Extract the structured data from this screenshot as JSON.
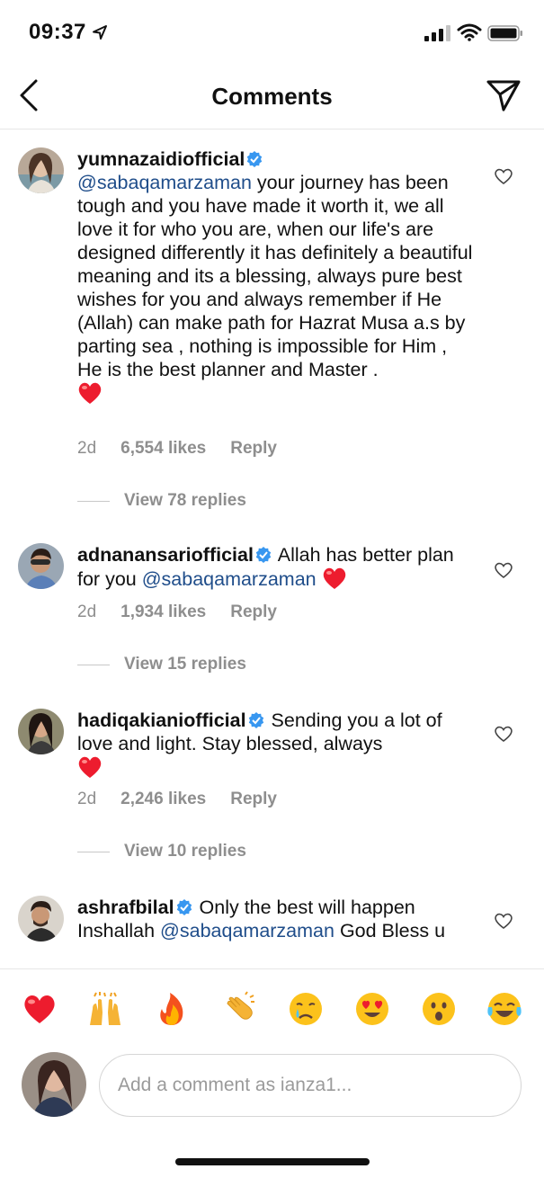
{
  "status": {
    "time": "09:37"
  },
  "header": {
    "title": "Comments"
  },
  "comments": [
    {
      "user": "yumnazaidiofficial",
      "mention": "@sabaqamarzaman",
      "text": " your journey has been tough and you have made it worth it, we all love it for who you are, when our life's are designed differently it has definitely a beautiful meaning and its a blessing, always pure best wishes for you and always remember if He (Allah) can make path for Hazrat Musa a.s  by parting sea , nothing is impossible for Him , He is the best planner and Master .",
      "age": "2d",
      "likes": "6,554 likes",
      "reply": "Reply",
      "view_replies": "View 78 replies"
    },
    {
      "user": "adnanansariofficial",
      "text_before": " Allah has better plan for you ",
      "mention": "@sabaqamarzaman",
      "age": "2d",
      "likes": "1,934 likes",
      "reply": "Reply",
      "view_replies": "View 15 replies"
    },
    {
      "user": "hadiqakianiofficial",
      "text": " Sending you a lot of love and light. Stay blessed, always",
      "age": "2d",
      "likes": "2,246 likes",
      "reply": "Reply",
      "view_replies": "View 10 replies"
    },
    {
      "user": "ashrafbilal",
      "text_before": " Only the best will happen Inshallah ",
      "mention": "@sabaqamarzaman",
      "text_after": " God Bless u"
    }
  ],
  "emoji_bar": [
    "heart-emoji",
    "raised-hands-emoji",
    "fire-emoji",
    "clapping-emoji",
    "crying-face-emoji",
    "heart-eyes-emoji",
    "surprised-face-emoji",
    "tears-of-joy-emoji"
  ],
  "composer": {
    "placeholder": "Add a comment as ianza1..."
  },
  "colors": {
    "mention": "#1f4d8a",
    "verified": "#3897f0",
    "meta": "#8e8e8e",
    "heart": "#ed1c2e"
  }
}
